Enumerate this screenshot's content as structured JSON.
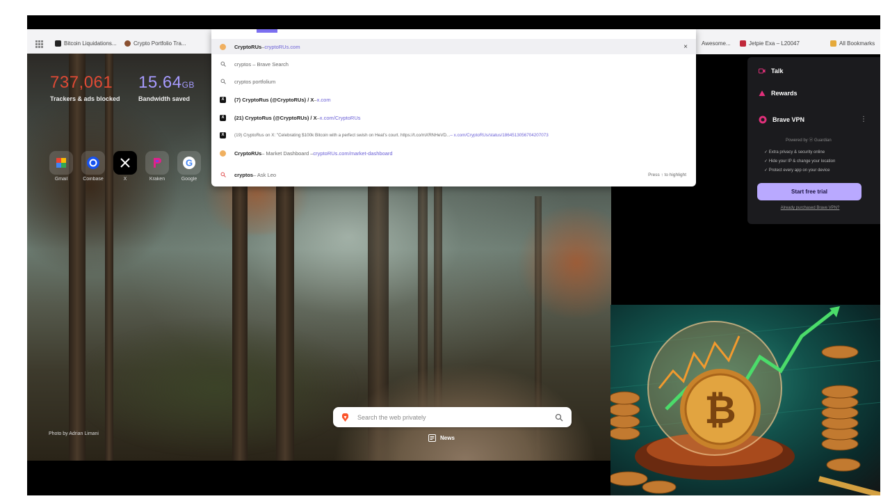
{
  "bookmarks": [
    {
      "label": "Bitcoin Liquidations...",
      "color": "#222"
    },
    {
      "label": "Crypto Portfolio Tra...",
      "color": "#8a5030"
    },
    {
      "label": "Awesome...",
      "color": "#999"
    },
    {
      "label": "Jetpie Exa – L20047",
      "color": "#c0283a"
    },
    {
      "label": "All Bookmarks",
      "color": "#e5a93a"
    }
  ],
  "stats": {
    "trackers_value": "737,061",
    "trackers_label": "Trackers & ads blocked",
    "bandwidth_value": "15.64",
    "bandwidth_unit": "GB",
    "bandwidth_label": "Bandwidth saved"
  },
  "shortcuts": [
    {
      "label": "Gmail",
      "icon": "multicolor-tile-icon"
    },
    {
      "label": "Coinbase",
      "icon": "coinbase-icon"
    },
    {
      "label": "X",
      "icon": "x-logo-icon"
    },
    {
      "label": "Kraken",
      "icon": "p-logo-icon"
    },
    {
      "label": "Google",
      "icon": "google-icon"
    }
  ],
  "omnibox": {
    "suggestions": [
      {
        "icon": "dot",
        "bold": "CryptoRUs",
        "text": " – ",
        "url": "cryptoRUs.com",
        "selected": true
      },
      {
        "icon": "search",
        "bold": "",
        "text": "cryptos – Brave Search",
        "url": ""
      },
      {
        "icon": "search",
        "bold": "",
        "text": "cryptos portfolium",
        "url": ""
      },
      {
        "icon": "x",
        "bold": "(7) CryptoRus (@CryptoRUs) / X",
        "text": " – ",
        "url": "x.com"
      },
      {
        "icon": "x",
        "bold": "(21) CryptoRus (@CryptoRUs) / X",
        "text": " – ",
        "url": "x.com/CryptoRUs"
      },
      {
        "icon": "x",
        "bold": "",
        "text": "(19) CryptoRus on X: \"Celebrating $100k Bitcoin with a perfect swish on Heat's court. https://t.co/mXRNHeVD...",
        "url": " – x.com/CryptoRUs/status/1864513056704207073"
      },
      {
        "icon": "dot",
        "bold": "CryptoRUs",
        "text": " – Market Dashboard – ",
        "url": "cryptoRUs.com/market-dashboard"
      },
      {
        "icon": "search",
        "bold": "cryptos",
        "text": " – Ask Leo",
        "url": ""
      }
    ],
    "close_label": "×",
    "hint": "Press ↑ to highlight"
  },
  "vpn": {
    "talk": "Talk",
    "rewards": "Rewards",
    "vpn_title": "Brave VPN",
    "powered": "Powered by ⓦ Guardian",
    "features": [
      "Extra privacy & security online",
      "Hide your IP & change your location",
      "Protect every app on your device"
    ],
    "cta": "Start free trial",
    "already": "Already purchased Brave VPN?"
  },
  "photo_credit": "Photo by Adrian Limani",
  "search": {
    "placeholder": "Search the web privately"
  },
  "news_label": "News",
  "colors": {
    "accent": "#b9a9ff",
    "trackers": "#e04a35",
    "bandwidth": "#a79bff"
  }
}
